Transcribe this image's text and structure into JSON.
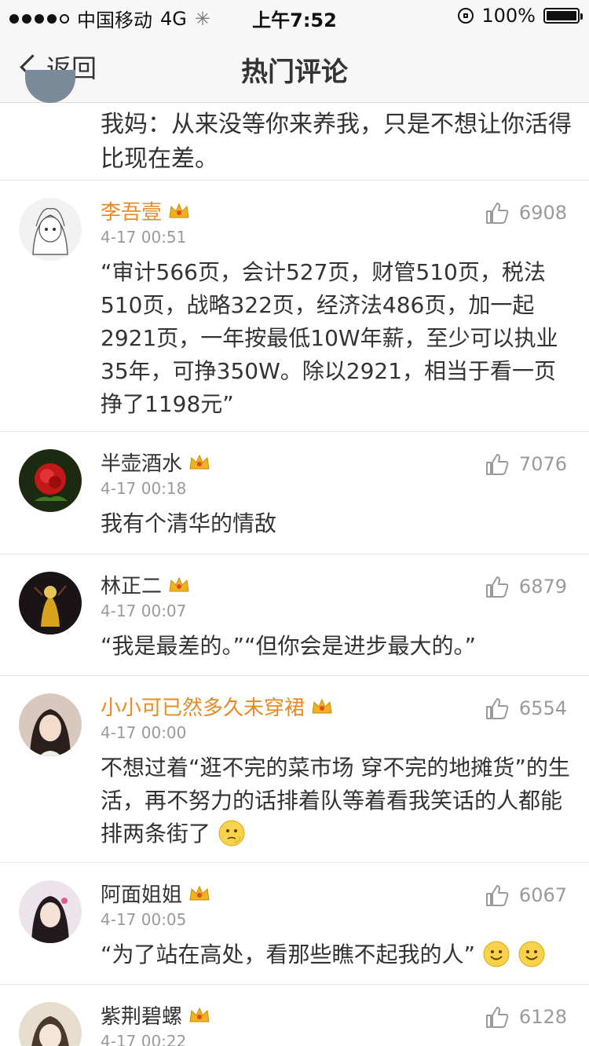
{
  "status_bar": {
    "carrier": "中国移动",
    "network": "4G",
    "time": "上午7:52",
    "battery": "100%"
  },
  "nav": {
    "back_label": "返回",
    "title": "热门评论"
  },
  "partial_comment": {
    "text": "我妈：从来没等你来养我，只是不想让你活得比现在差。"
  },
  "comments": [
    {
      "name": "李吾壹",
      "time": "4-17 00:51",
      "likes": "6908",
      "text": "“审计566页，会计527页，财管510页，税法510页，战略322页，经济法486页，加一起2921页，一年按最低10W年薪，至少可以执业35年，可挣350W。除以2921，相当于看一页挣了1198元”"
    },
    {
      "name": "半壶酒水",
      "time": "4-17 00:18",
      "likes": "7076",
      "text": "我有个清华的情敌"
    },
    {
      "name": "林正二",
      "time": "4-17 00:07",
      "likes": "6879",
      "text": "“我是最差的。”“但你会是进步最大的。”"
    },
    {
      "name": "小小可已然多久未穿裙",
      "time": "4-17 00:00",
      "likes": "6554",
      "text": "不想过着“逛不完的菜市场 穿不完的地摊货”的生活，再不努力的话排着队等着看我笑话的人都能排两条街了"
    },
    {
      "name": "阿面姐姐",
      "time": "4-17 00:05",
      "likes": "6067",
      "text": "“为了站在高处，看那些瞧不起我的人”"
    },
    {
      "name": "紫荆碧螺",
      "time": "4-17 00:22",
      "likes": "6128",
      "text": ""
    }
  ],
  "colors": {
    "vip_name": "#e88a24",
    "meta_gray": "#9a9a9a",
    "crown_gold": "#f2b21e"
  }
}
